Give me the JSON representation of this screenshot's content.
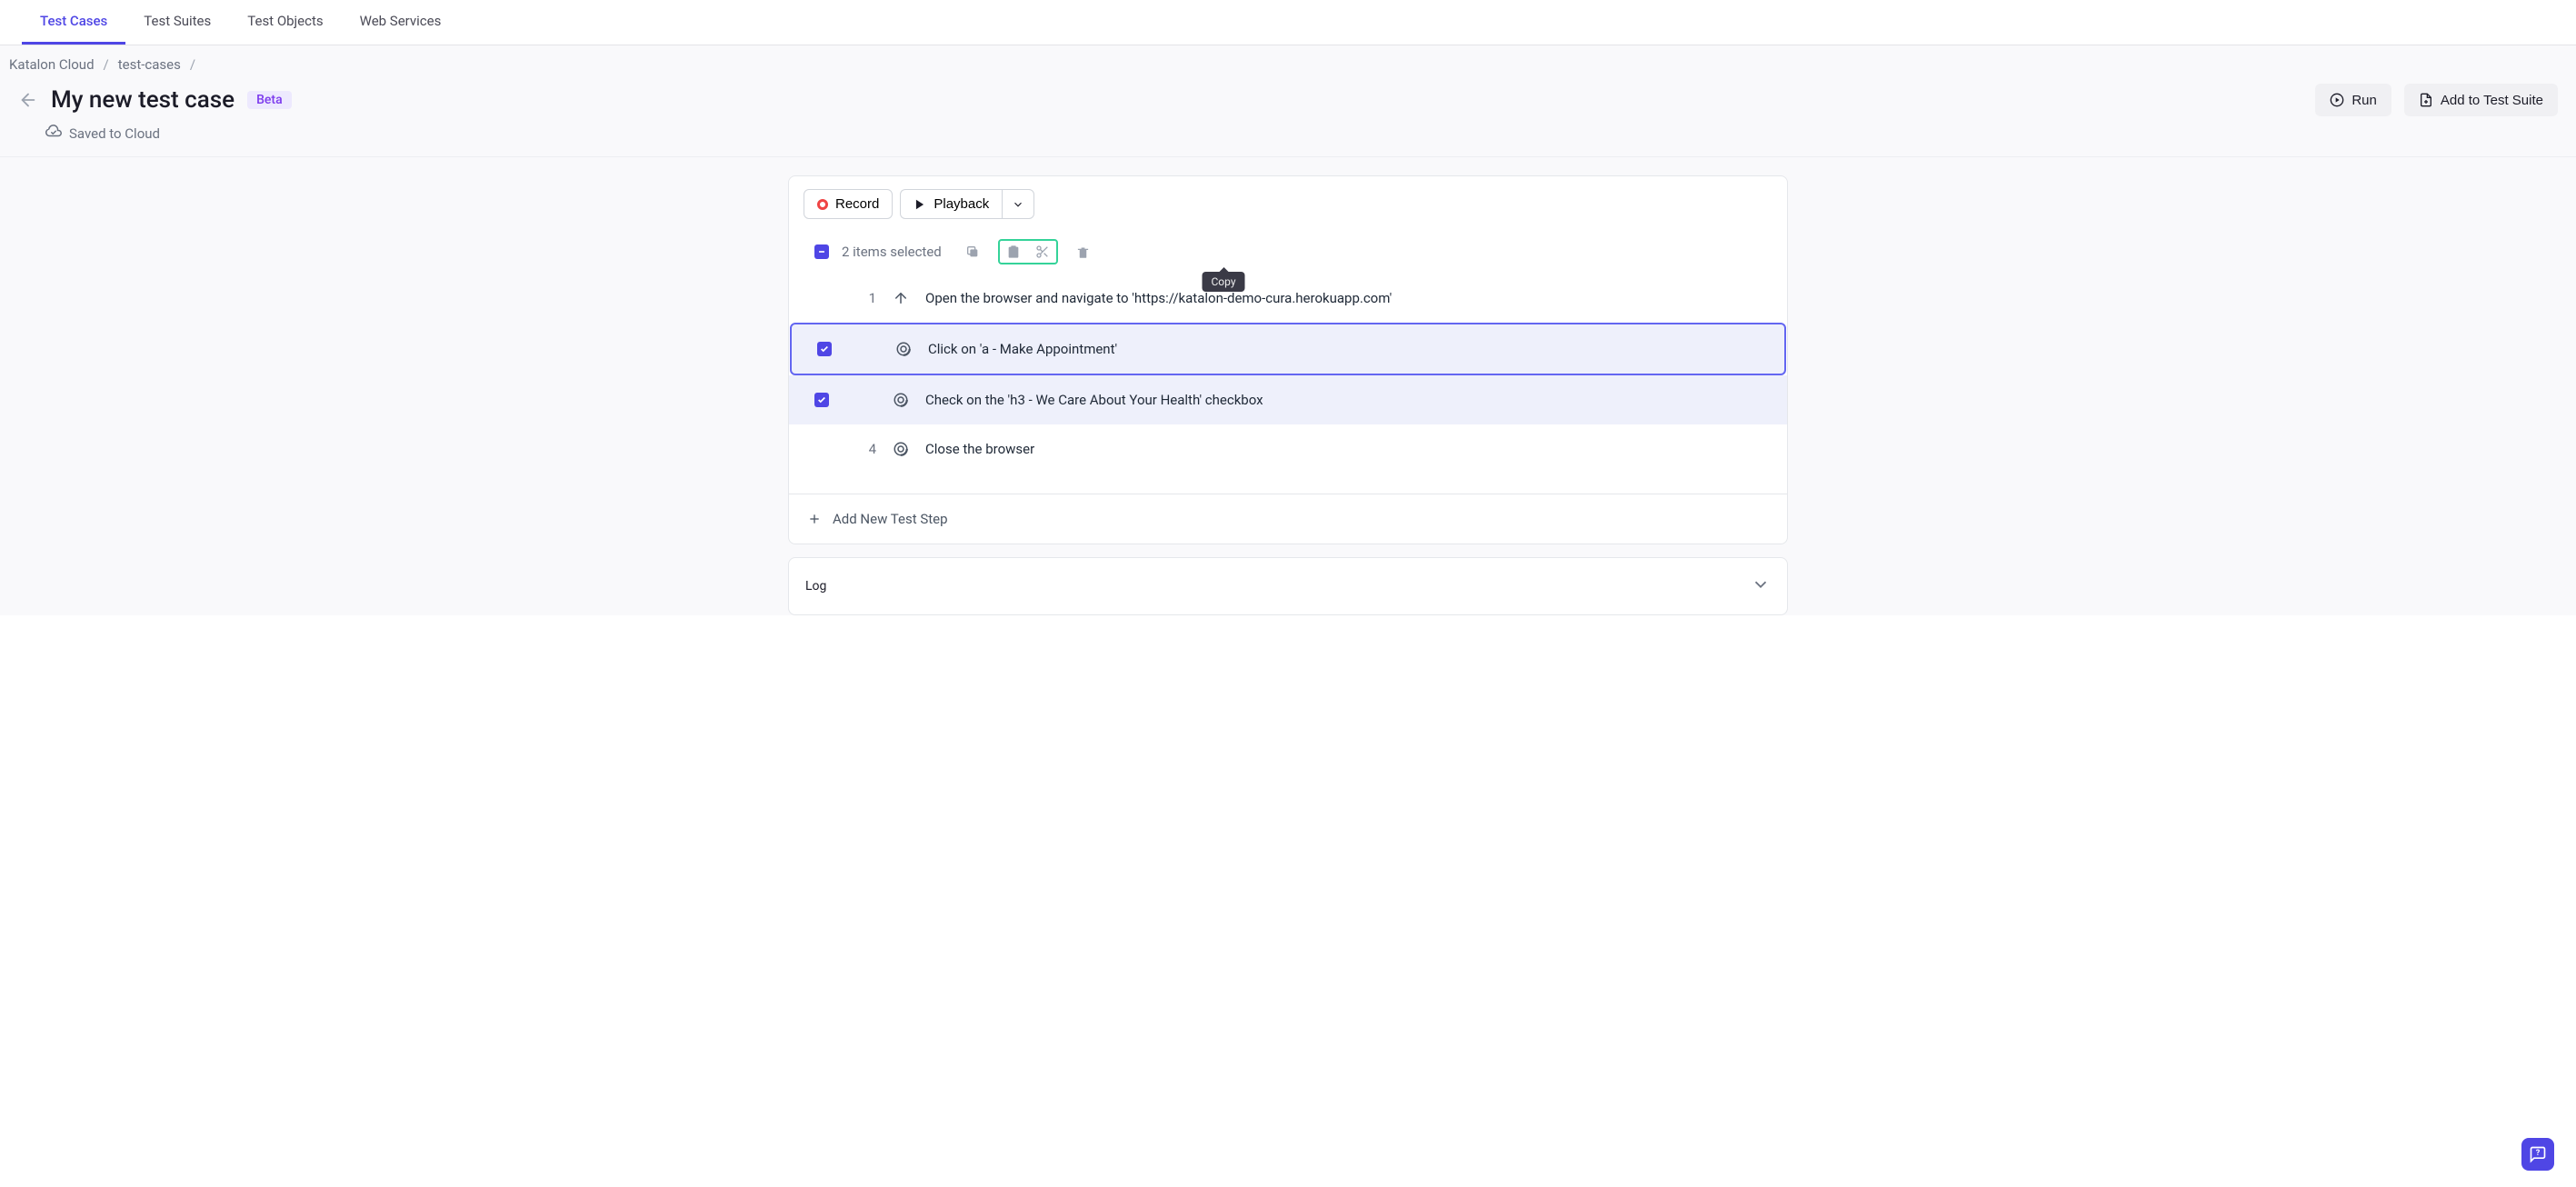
{
  "tabs": {
    "test_cases": "Test Cases",
    "test_suites": "Test Suites",
    "test_objects": "Test Objects",
    "web_services": "Web Services"
  },
  "breadcrumb": {
    "root": "Katalon Cloud",
    "section": "test-cases"
  },
  "header": {
    "title": "My new test case",
    "badge": "Beta",
    "saved_status": "Saved to Cloud",
    "run_label": "Run",
    "add_suite_label": "Add to Test Suite"
  },
  "toolbar": {
    "record_label": "Record",
    "playback_label": "Playback"
  },
  "selection": {
    "count_text": "2 items selected",
    "tooltip": "Copy"
  },
  "steps": [
    {
      "num": "1",
      "checked": false,
      "icon": "navigate",
      "text": "Open the browser and navigate to 'https://katalon-demo-cura.herokuapp.com'"
    },
    {
      "num": "",
      "checked": true,
      "icon": "target",
      "text": "Click on 'a - Make Appointment'"
    },
    {
      "num": "",
      "checked": true,
      "icon": "target",
      "text": "Check on the 'h3 - We Care About Your Health' checkbox"
    },
    {
      "num": "4",
      "checked": false,
      "icon": "target",
      "text": "Close the browser"
    }
  ],
  "footer": {
    "add_step_label": "Add New Test Step",
    "log_label": "Log"
  }
}
